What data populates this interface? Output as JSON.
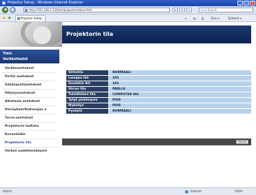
{
  "window": {
    "title": "Projector Setup - Windows Internet Explorer",
    "buttons": [
      "_",
      "□",
      "×"
    ]
  },
  "address_bar": {
    "back_icon": "back-arrow-icon",
    "forward_icon": "forward-arrow-icon",
    "url": "http://192.168.1.10/html/projectorstatus.html",
    "search_placeholder": "Live Search",
    "refresh_glyph": "↻",
    "stop_glyph": "×",
    "go_glyph": "→"
  },
  "tab_bar": {
    "tab_label": "Projector Setup",
    "home_label": "⌂",
    "feeds_label": "▤",
    "print_label": "⎙",
    "page_label": "Sivu ▾",
    "tools_label": "Työkalut ▾"
  },
  "page": {
    "heading": "Projektorin tila",
    "sidebar_header_line1": "Yleis",
    "sidebar_header_line2": "Verkkotiedot",
    "sidebar_items": [
      {
        "label": "Verkkoasetukset",
        "active": false
      },
      {
        "label": "Portin asetukset",
        "active": false
      },
      {
        "label": "Sähköpostiasetukset",
        "active": false
      },
      {
        "label": "Hälytysasetukset",
        "active": false
      },
      {
        "label": "Aikataulu asetukset",
        "active": false
      },
      {
        "label": "Päiväykset/Kellonajan a",
        "active": false
      },
      {
        "label": "Turva-asetukset",
        "active": false
      },
      {
        "label": "Projektorin hallinta",
        "active": false
      },
      {
        "label": "Kuvanäädin",
        "active": false
      },
      {
        "label": "Projektorin tila",
        "active": true
      },
      {
        "label": "Verkon uudelleenkäynni",
        "active": false
      }
    ],
    "status_rows": [
      {
        "key": "Virhetila",
        "value": "NORMAALI"
      },
      {
        "key": "Lamppu ikä",
        "value": "101"
      },
      {
        "key": "Suodatin ikä",
        "value": "101"
      },
      {
        "key": "Virran tila",
        "value": "PÄÄLLE"
      },
      {
        "key": "Tulolähteen tila",
        "value": "COMPUTER IN1"
      },
      {
        "key": "Tyhjä päälle/pois",
        "value": "POIS"
      },
      {
        "key": "Mykistys",
        "value": "POIS"
      },
      {
        "key": "Pysäytä",
        "value": "NORMAALI"
      }
    ],
    "refresh_button": "Päivitä"
  },
  "status_bar": {
    "left_text": "Valmis",
    "zone_text": "Internet",
    "zoom_text": "100%"
  },
  "colors": {
    "heading_bg": "#1a3870",
    "key_bg": "#2a3e63",
    "value_bg": "#b8d2ec",
    "active_link": "#2b3fa8",
    "refresh_bar_bg": "#474747"
  }
}
